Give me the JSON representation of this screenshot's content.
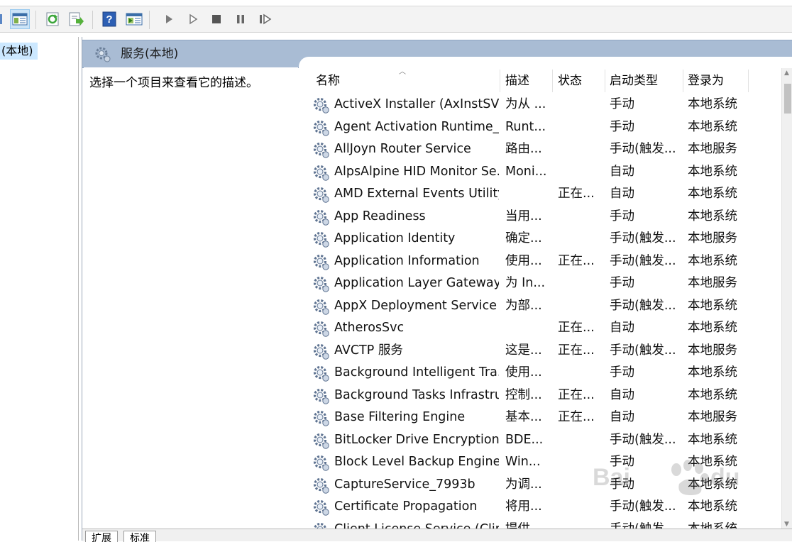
{
  "toolbar": {
    "icons": [
      "back-icon",
      "show-tree-icon",
      "refresh-icon",
      "export-list-icon",
      "help-icon",
      "properties-icon",
      "start-service-icon",
      "start-service-alt-icon",
      "stop-service-icon",
      "pause-service-icon",
      "restart-service-icon"
    ]
  },
  "tree": {
    "selected_label": "(本地)"
  },
  "title": {
    "label": "服务(本地)"
  },
  "description": {
    "text": "选择一个项目来查看它的描述。"
  },
  "columns": {
    "name": "名称",
    "description": "描述",
    "status": "状态",
    "startup": "启动类型",
    "logon": "登录为"
  },
  "services": [
    {
      "name": "ActiveX Installer (AxInstSV)",
      "desc": "为从 ...",
      "status": "",
      "startup": "手动",
      "logon": "本地系统"
    },
    {
      "name": "Agent Activation Runtime_...",
      "desc": "Runt...",
      "status": "",
      "startup": "手动",
      "logon": "本地系统"
    },
    {
      "name": "AllJoyn Router Service",
      "desc": "路由...",
      "status": "",
      "startup": "手动(触发...",
      "logon": "本地服务"
    },
    {
      "name": "AlpsAlpine HID Monitor Se...",
      "desc": "Moni...",
      "status": "",
      "startup": "自动",
      "logon": "本地系统"
    },
    {
      "name": "AMD External Events Utility",
      "desc": "",
      "status": "正在...",
      "startup": "自动",
      "logon": "本地系统"
    },
    {
      "name": "App Readiness",
      "desc": "当用...",
      "status": "",
      "startup": "手动",
      "logon": "本地系统"
    },
    {
      "name": "Application Identity",
      "desc": "确定...",
      "status": "",
      "startup": "手动(触发...",
      "logon": "本地服务"
    },
    {
      "name": "Application Information",
      "desc": "使用...",
      "status": "正在...",
      "startup": "手动(触发...",
      "logon": "本地系统"
    },
    {
      "name": "Application Layer Gateway ...",
      "desc": "为 In...",
      "status": "",
      "startup": "手动",
      "logon": "本地服务"
    },
    {
      "name": "AppX Deployment Service ...",
      "desc": "为部...",
      "status": "",
      "startup": "手动(触发...",
      "logon": "本地系统"
    },
    {
      "name": "AtherosSvc",
      "desc": "",
      "status": "正在...",
      "startup": "自动",
      "logon": "本地系统"
    },
    {
      "name": "AVCTP 服务",
      "desc": "这是...",
      "status": "正在...",
      "startup": "手动(触发...",
      "logon": "本地服务"
    },
    {
      "name": "Background Intelligent Tra...",
      "desc": "使用...",
      "status": "",
      "startup": "手动",
      "logon": "本地系统"
    },
    {
      "name": "Background Tasks Infrastru...",
      "desc": "控制...",
      "status": "正在...",
      "startup": "自动",
      "logon": "本地系统"
    },
    {
      "name": "Base Filtering Engine",
      "desc": "基本...",
      "status": "正在...",
      "startup": "自动",
      "logon": "本地服务"
    },
    {
      "name": "BitLocker Drive Encryption ...",
      "desc": "BDE...",
      "status": "",
      "startup": "手动(触发...",
      "logon": "本地系统"
    },
    {
      "name": "Block Level Backup Engine ...",
      "desc": "Win...",
      "status": "",
      "startup": "手动",
      "logon": "本地系统"
    },
    {
      "name": "CaptureService_7993b",
      "desc": "为调...",
      "status": "",
      "startup": "手动",
      "logon": "本地系统"
    },
    {
      "name": "Certificate Propagation",
      "desc": "将用...",
      "status": "",
      "startup": "手动(触发...",
      "logon": "本地系统"
    },
    {
      "name": "Client License Service (Clip...",
      "desc": "提供...",
      "status": "",
      "startup": "手动(触发...",
      "logon": "本地系统"
    }
  ],
  "tabs": {
    "extended": "扩展",
    "standard": "标准"
  },
  "watermark": {
    "text": "Baidu经验",
    "url": "jingyan.baidu.com"
  },
  "colors": {
    "title_bar": "#a9bcd4",
    "selection": "#cce8ff",
    "toolbar": "#f3f3f3"
  }
}
